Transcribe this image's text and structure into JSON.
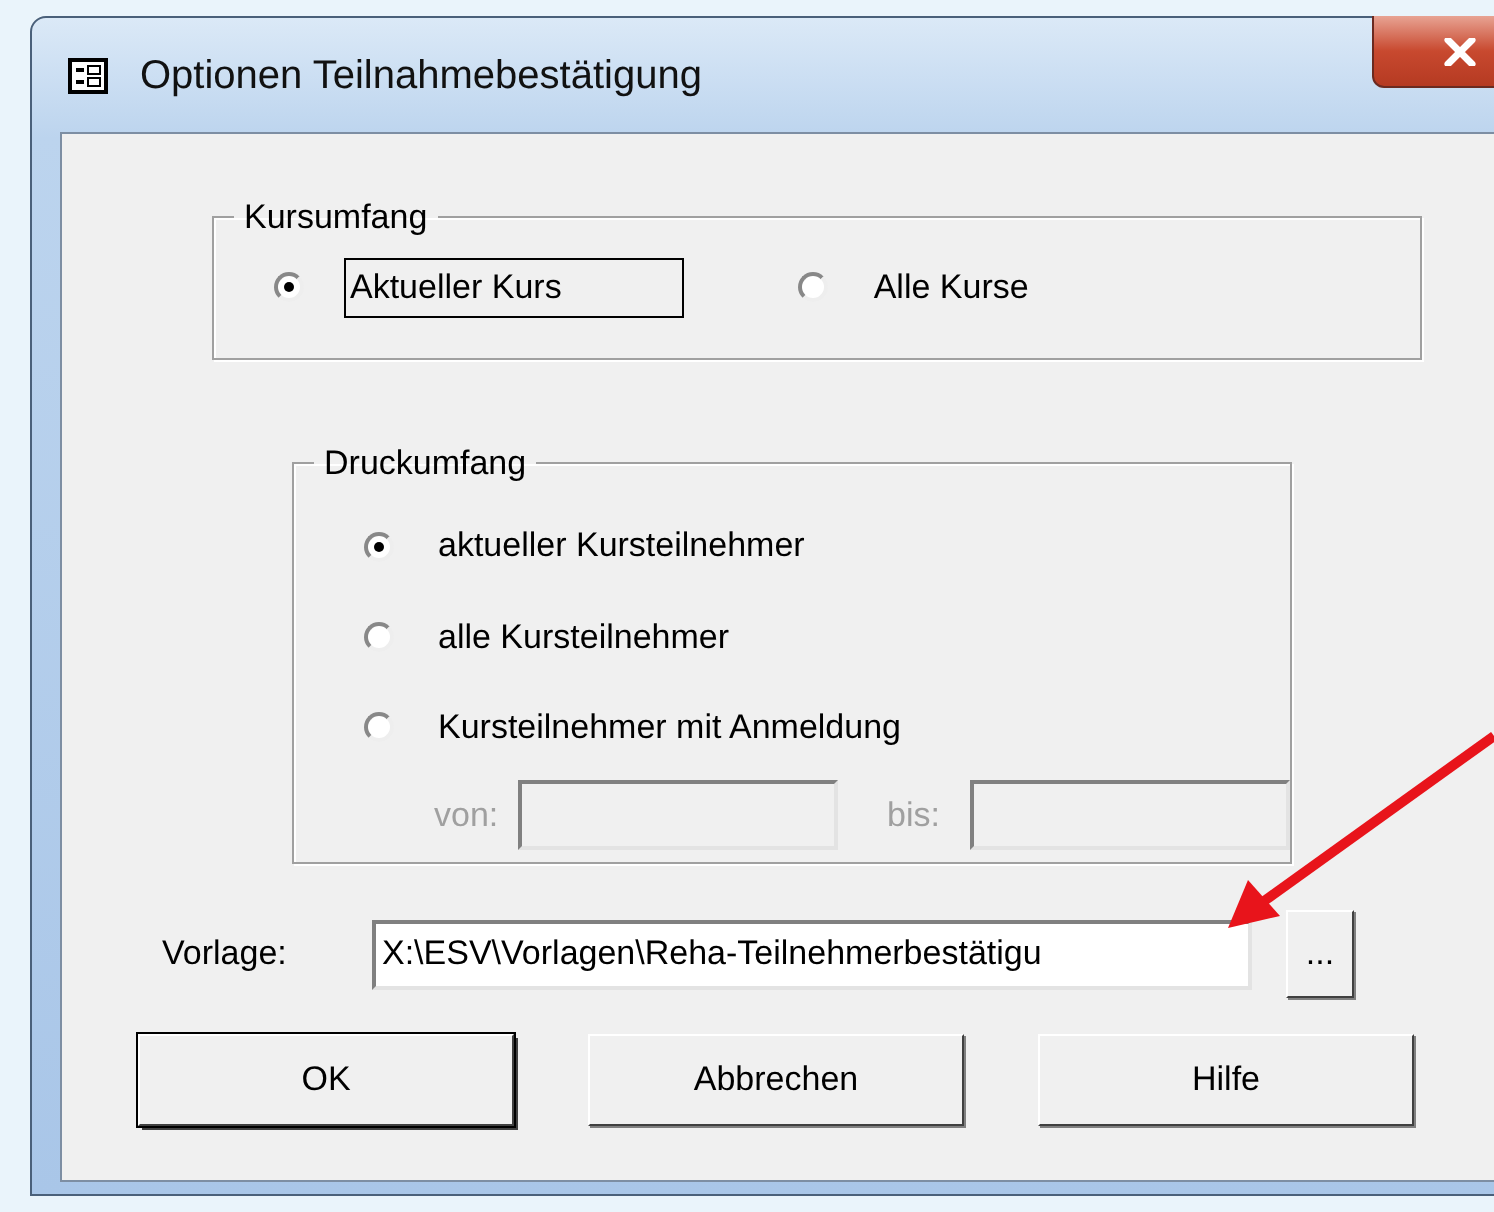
{
  "window": {
    "title": "Optionen Teilnahmebestätigung"
  },
  "kursumfang": {
    "title": "Kursumfang",
    "options": [
      {
        "label": "Aktueller Kurs",
        "selected": true,
        "focused": true
      },
      {
        "label": "Alle Kurse",
        "selected": false,
        "focused": false
      }
    ]
  },
  "druckumfang": {
    "title": "Druckumfang",
    "options": [
      {
        "label": "aktueller Kursteilnehmer",
        "selected": true
      },
      {
        "label": "alle Kursteilnehmer",
        "selected": false
      },
      {
        "label": "Kursteilnehmer mit Anmeldung",
        "selected": false
      }
    ],
    "range": {
      "from_label": "von:",
      "to_label": "bis:",
      "disabled": true
    }
  },
  "vorlage": {
    "label": "Vorlage:",
    "value": "X:\\ESV\\Vorlagen\\Reha-Teilnehmerbestätigu",
    "browse": "..."
  },
  "buttons": [
    {
      "label": "OK",
      "default": true
    },
    {
      "label": "Abbrechen",
      "default": false
    },
    {
      "label": "Hilfe",
      "default": false
    }
  ]
}
